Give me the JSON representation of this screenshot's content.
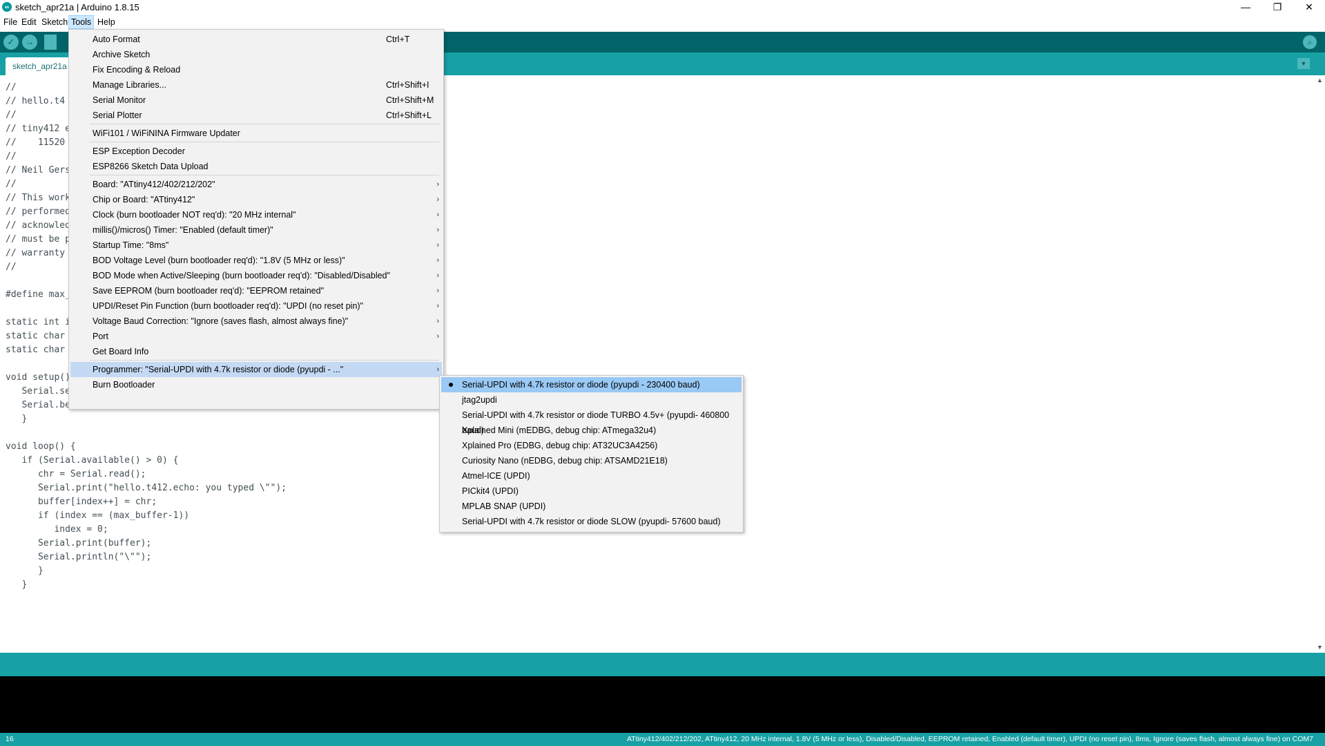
{
  "window": {
    "title": "sketch_apr21a | Arduino 1.8.15",
    "icon_label": "∞",
    "minimize": "—",
    "maximize": "❐",
    "close": "✕"
  },
  "menubar": [
    "File",
    "Edit",
    "Sketch",
    "Tools",
    "Help"
  ],
  "toolbar": {
    "verify_icon": "✓",
    "upload_icon": "→",
    "serial_monitor_icon": "⌕"
  },
  "tab": {
    "label": "sketch_apr21a",
    "menu_icon": "▼"
  },
  "editor_lines": [
    "//",
    "// hello.t4",
    "//",
    "// tiny412 e",
    "//    11520",
    "//",
    "// Neil Gers",
    "//",
    "// This work",
    "// performed",
    "// acknowled",
    "// must be p",
    "// warranty",
    "//",
    "",
    "#define max_",
    "",
    "static int i",
    "static char",
    "static char",
    "",
    "void setup()",
    "   Serial.se",
    "   Serial.be",
    "   }",
    "",
    "void loop() {",
    "   if (Serial.available() > 0) {",
    "      chr = Serial.read();",
    "      Serial.print(\"hello.t412.echo: you typed \\\"\");",
    "      buffer[index++] = chr;",
    "      if (index == (max_buffer-1))",
    "         index = 0;",
    "      Serial.print(buffer);",
    "      Serial.println(\"\\\"\");",
    "      }",
    "   }"
  ],
  "tools_menu": {
    "group1": [
      {
        "label": "Auto Format",
        "shortcut": "Ctrl+T"
      },
      {
        "label": "Archive Sketch",
        "shortcut": ""
      },
      {
        "label": "Fix Encoding & Reload",
        "shortcut": ""
      },
      {
        "label": "Manage Libraries...",
        "shortcut": "Ctrl+Shift+I"
      },
      {
        "label": "Serial Monitor",
        "shortcut": "Ctrl+Shift+M"
      },
      {
        "label": "Serial Plotter",
        "shortcut": "Ctrl+Shift+L"
      }
    ],
    "group2": [
      {
        "label": "WiFi101 / WiFiNINA Firmware Updater"
      }
    ],
    "group3": [
      {
        "label": "ESP Exception Decoder"
      },
      {
        "label": "ESP8266 Sketch Data Upload"
      }
    ],
    "group4": [
      {
        "label": "Board: \"ATtiny412/402/212/202\""
      },
      {
        "label": "Chip or Board: \"ATtiny412\""
      },
      {
        "label": "Clock (burn bootloader NOT req'd): \"20 MHz internal\""
      },
      {
        "label": "millis()/micros() Timer: \"Enabled (default timer)\""
      },
      {
        "label": "Startup Time: \"8ms\""
      },
      {
        "label": "BOD Voltage Level (burn bootloader req'd): \"1.8V (5 MHz or less)\""
      },
      {
        "label": "BOD Mode when Active/Sleeping (burn bootloader req'd): \"Disabled/Disabled\""
      },
      {
        "label": "Save EEPROM (burn bootloader req'd): \"EEPROM retained\""
      },
      {
        "label": "UPDI/Reset Pin Function (burn bootloader req'd): \"UPDI (no reset pin)\""
      },
      {
        "label": "Voltage Baud Correction: \"Ignore (saves flash, almost always fine)\""
      },
      {
        "label": "Port"
      },
      {
        "label": "Get Board Info"
      }
    ],
    "group5": [
      {
        "label": "Programmer: \"Serial-UPDI with 4.7k resistor or diode (pyupdi - ...\""
      },
      {
        "label": "Burn Bootloader"
      }
    ],
    "submenu_arrow": "›"
  },
  "programmer_submenu": [
    {
      "label": "Serial-UPDI with 4.7k resistor or diode (pyupdi - 230400 baud)",
      "selected": true
    },
    {
      "label": "jtag2updi"
    },
    {
      "label": "Serial-UPDI with 4.7k resistor or diode TURBO 4.5v+ (pyupdi- 460800 baud)"
    },
    {
      "label": "Xplained Mini (mEDBG, debug chip: ATmega32u4)"
    },
    {
      "label": "Xplained Pro (EDBG, debug chip: AT32UC3A4256)"
    },
    {
      "label": "Curiosity Nano (nEDBG, debug chip: ATSAMD21E18)"
    },
    {
      "label": "Atmel-ICE (UPDI)"
    },
    {
      "label": "PICkit4 (UPDI)"
    },
    {
      "label": "MPLAB SNAP (UPDI)"
    },
    {
      "label": "Serial-UPDI with 4.7k resistor or diode SLOW (pyupdi- 57600 baud)"
    }
  ],
  "status": {
    "line_number": "16",
    "board_info": "ATtiny412/402/212/202, ATtiny412, 20 MHz internal, 1.8V (5 MHz or less), Disabled/Disabled, EEPROM retained, Enabled (default timer), UPDI (no reset pin), 8ms, Ignore (saves flash, almost always fine) on COM7"
  },
  "colors": {
    "toolbar": "#006468",
    "tabs_bar": "#17a1a5",
    "menu_highlight": "#c4d9f3",
    "submenu_selected": "#99c9f5"
  }
}
